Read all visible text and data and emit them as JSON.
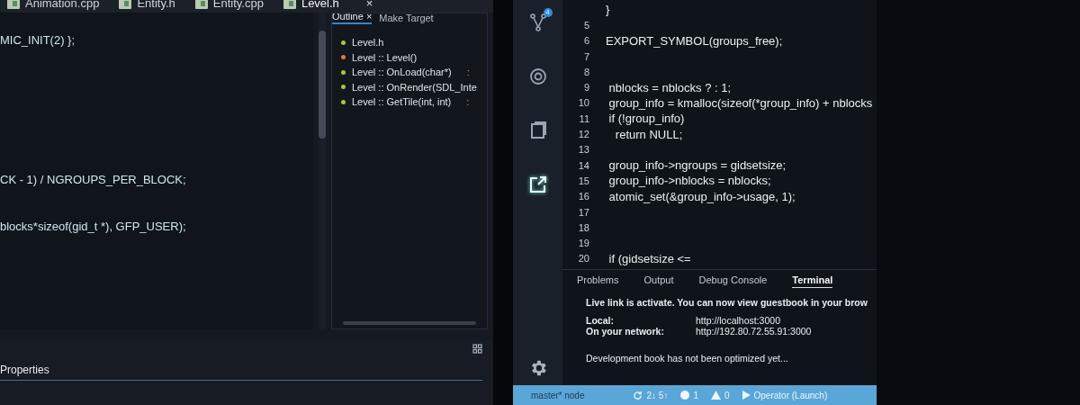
{
  "left_screen": {
    "tabs": [
      {
        "label": "Animation.cpp",
        "selected": false
      },
      {
        "label": "Entity.h",
        "selected": false
      },
      {
        "label": "Entity.cpp",
        "selected": false
      },
      {
        "label": "Level.h",
        "selected": true
      }
    ],
    "close_label": "×",
    "code_lines": [
      {
        "text": "MIC_INIT(2) };"
      },
      {
        "text": "CK - 1) / NGROUPS_PER_BLOCK;"
      },
      {
        "text": "blocks*sizeof(gid_t *), GFP_USER);"
      }
    ],
    "outline": {
      "tabs": [
        {
          "label": "Outline ×",
          "selected": true
        },
        {
          "label": "Make Target",
          "selected": false
        }
      ],
      "items": [
        {
          "label": "Level.h",
          "color": "#9ccc3c"
        },
        {
          "label": "Level :: Level()",
          "color": "#e07a3a"
        },
        {
          "label": "Level :: OnLoad(char*)",
          "color": "#9ccc3c",
          "suffix": ":"
        },
        {
          "label": "Level :: OnRender(SDL_Inte",
          "color": "#9ccc3c"
        },
        {
          "label": "Level :: GetTile(int, int)",
          "color": "#9ccc3c",
          "suffix": ":"
        }
      ]
    },
    "properties": {
      "title": "Properties"
    }
  },
  "right_screen": {
    "activity": [
      {
        "kind": "branch",
        "badge": "4",
        "selected": false
      },
      {
        "kind": "target",
        "selected": false
      },
      {
        "kind": "copy",
        "selected": false
      },
      {
        "kind": "external",
        "selected": true
      }
    ],
    "code_lines": [
      {
        "text": "}"
      },
      {
        "number": "5"
      },
      {
        "number": "6",
        "text": "EXPORT_SYMBOL(groups_free);"
      },
      {
        "number": "7"
      },
      {
        "number": "8"
      },
      {
        "number": "9",
        "text": " nblocks = nblocks ? : 1;"
      },
      {
        "number": "10",
        "text": " group_info = kmalloc(sizeof(*group_info) + nblocks"
      },
      {
        "number": "11",
        "text": " if (!group_info)"
      },
      {
        "number": "12",
        "text": "   return NULL;"
      },
      {
        "number": "13"
      },
      {
        "number": "14",
        "text": " group_info->ngroups = gidsetsize;"
      },
      {
        "number": "15",
        "text": " group_info->nblocks = nblocks;"
      },
      {
        "number": "16",
        "text": " atomic_set(&group_info->usage, 1);"
      },
      {
        "number": "17"
      },
      {
        "number": "18"
      },
      {
        "number": "19"
      },
      {
        "number": "20",
        "text": " if (gidsetsize <="
      }
    ],
    "panel_tabs": [
      {
        "label": "Problems",
        "selected": false
      },
      {
        "label": "Output",
        "selected": false
      },
      {
        "label": "Debug Console",
        "selected": false
      },
      {
        "label": "Terminal",
        "selected": true
      }
    ],
    "terminal": {
      "message": "Live link is activate. You can now view **guestbook** in your brow",
      "links": [
        {
          "label": "Local:",
          "url": "http://localhost:3000"
        },
        {
          "label": "On your network:",
          "url": "http://192.80.72.55.91:3000"
        }
      ],
      "note": "Development book has not been optimized yet..."
    },
    "status_bar": {
      "branch": "master* node",
      "sync": "2↓  5↑",
      "errors": "1",
      "warnings": "0",
      "launch": "Operator (Launch)"
    }
  }
}
